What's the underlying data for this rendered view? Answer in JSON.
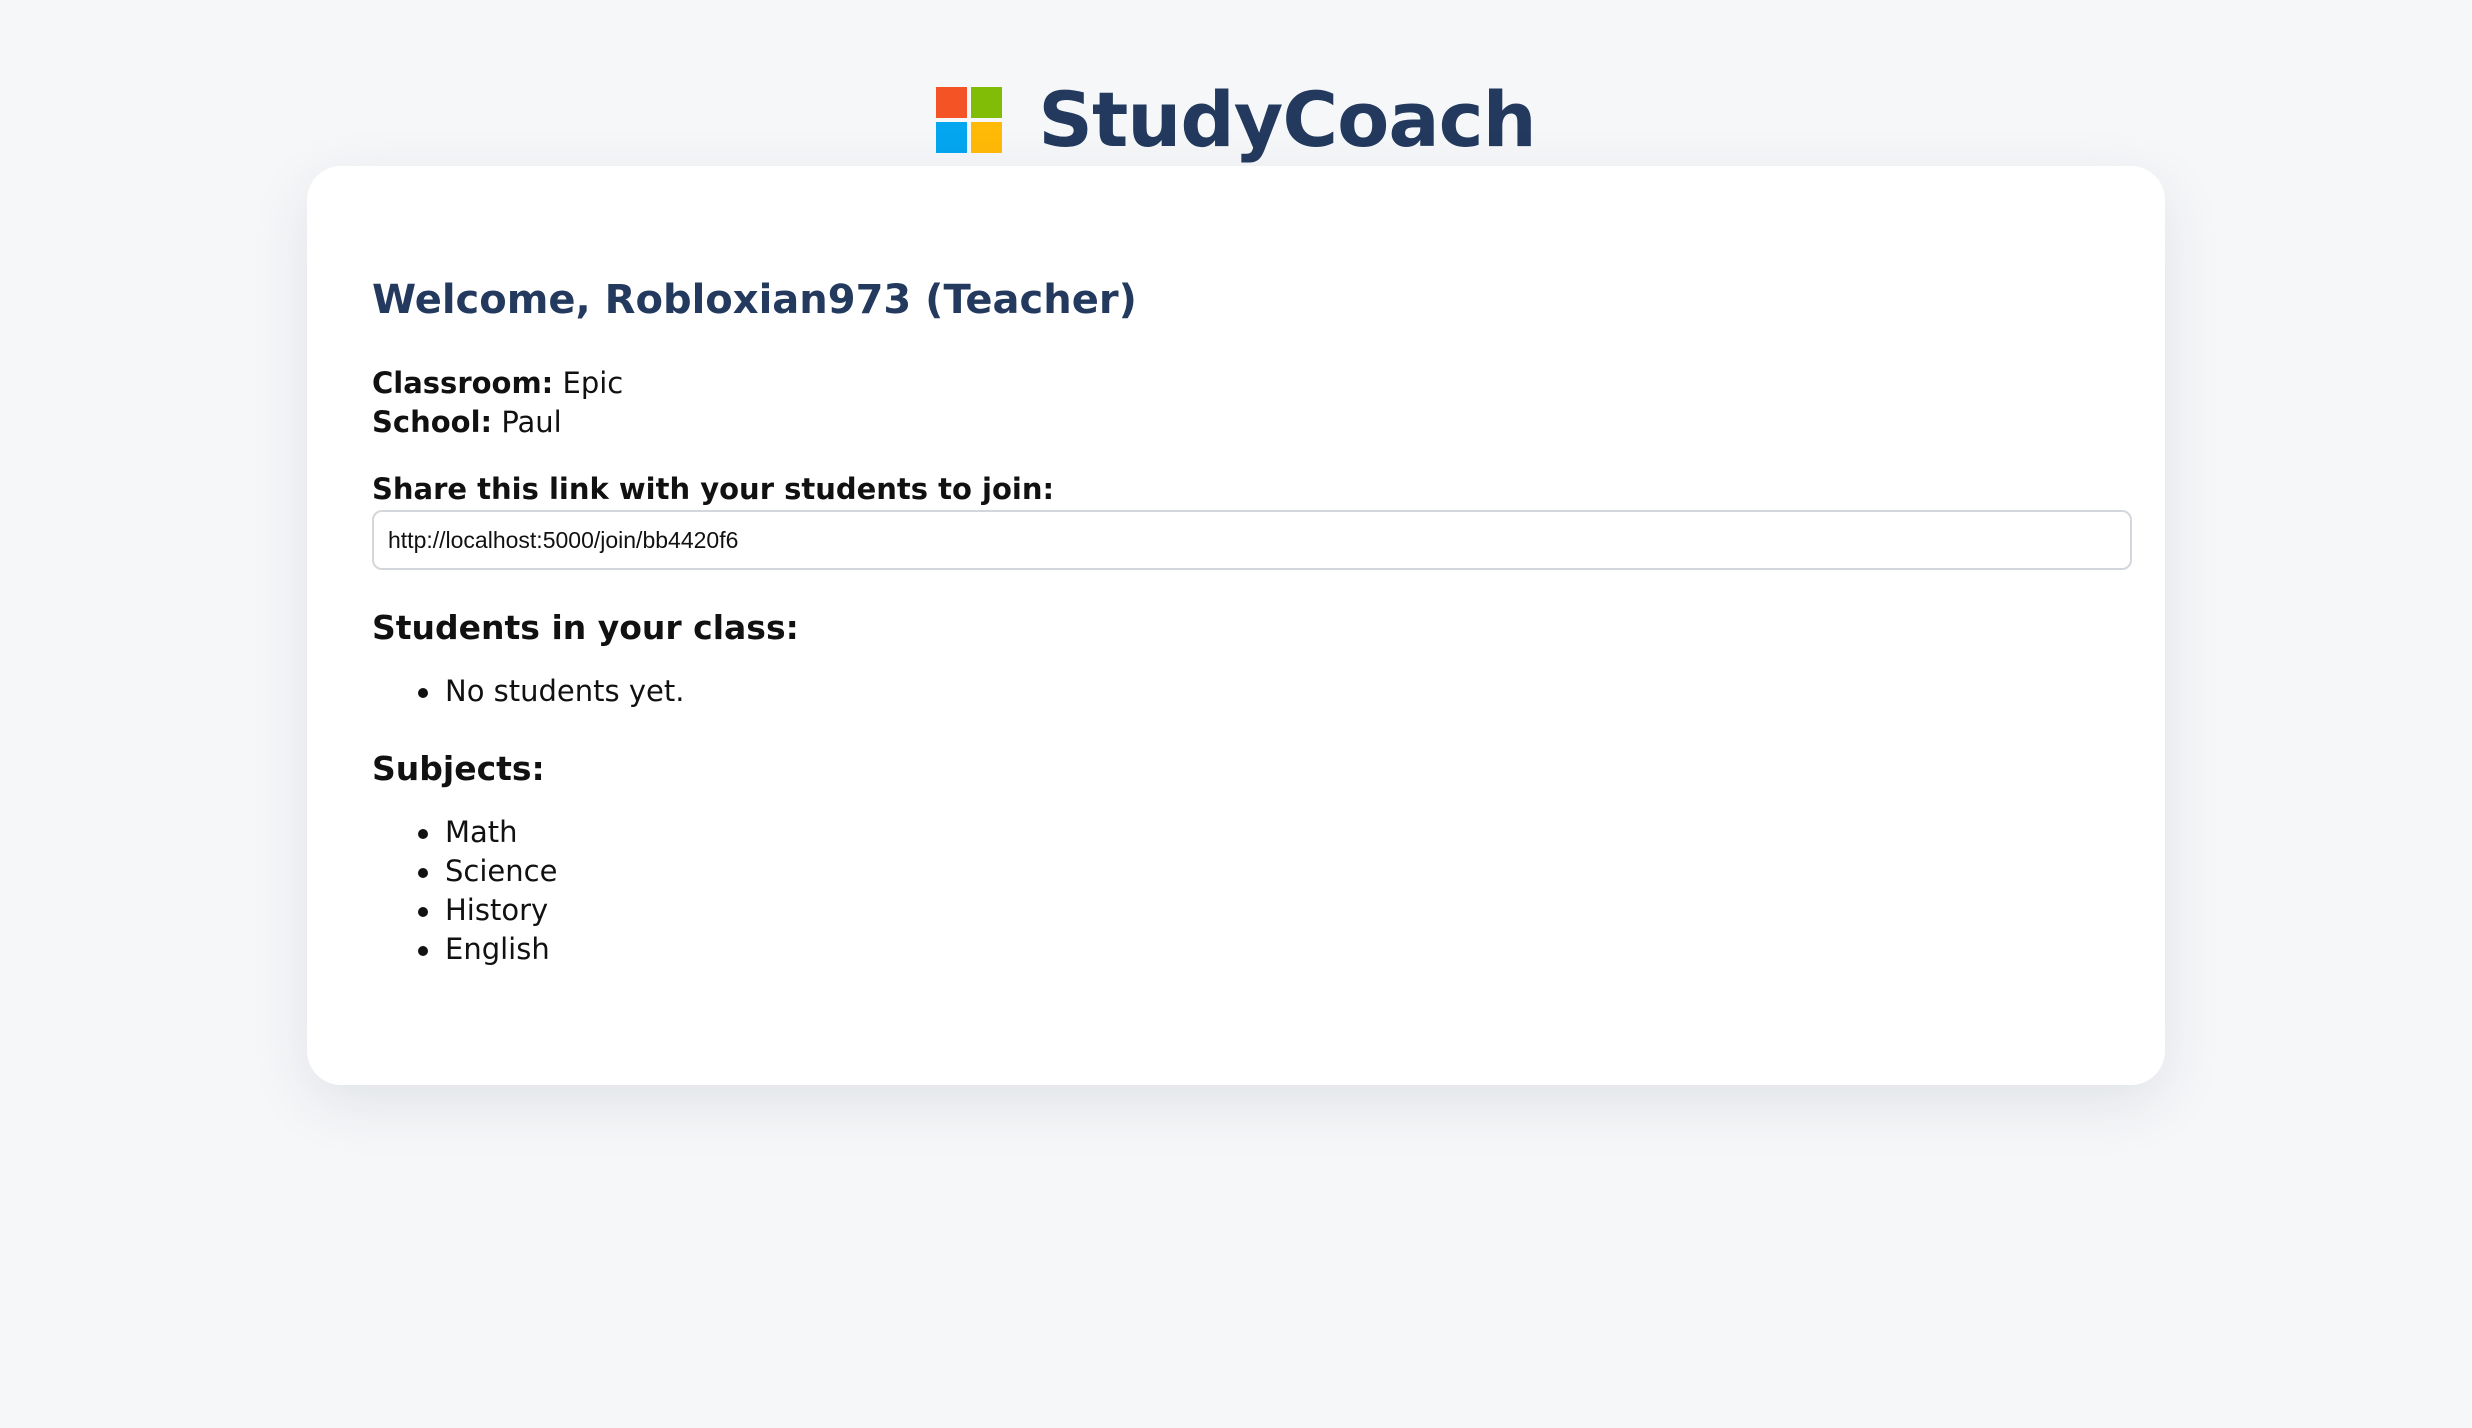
{
  "app": {
    "title": "StudyCoach",
    "logo_colors": [
      "#f35325",
      "#81bc06",
      "#05a6f0",
      "#ffba08"
    ]
  },
  "dashboard": {
    "welcome": "Welcome, Robloxian973 (Teacher)",
    "classroom_label": "Classroom:",
    "classroom_value": "Epic",
    "school_label": "School:",
    "school_value": "Paul",
    "share_label": "Share this link with your students to join:",
    "share_link": "http://localhost:5000/join/bb4420f6",
    "students_heading": "Students in your class:",
    "students": [
      "No students yet."
    ],
    "subjects_heading": "Subjects:",
    "subjects": [
      "Math",
      "Science",
      "History",
      "English"
    ]
  },
  "theme": {
    "heading_color": "#233a5e",
    "background": "#f6f7f9"
  }
}
